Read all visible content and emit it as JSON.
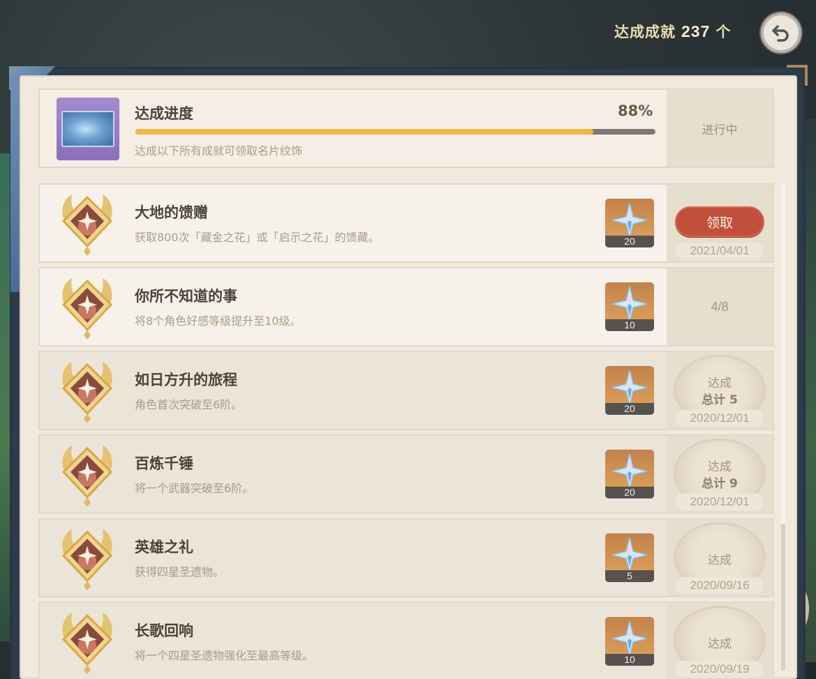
{
  "header": {
    "achieved_label": "达成成就",
    "achieved_count": "237",
    "achieved_unit": "个",
    "back_icon": "back-arrow-icon"
  },
  "progress": {
    "title": "达成进度",
    "percent_label": "88%",
    "percent_value": 88,
    "subtitle": "达成以下所有成就可领取名片纹饰",
    "status": "进行中",
    "colors": {
      "fill": "#f0b748",
      "track": "#7a7873"
    }
  },
  "achievements": [
    {
      "title": "大地的馈赠",
      "desc": "获取800次「藏金之花」或「启示之花」的馈藏。",
      "reward": "20",
      "claim_label": "领取",
      "date": "2021/04/01"
    },
    {
      "title": "你所不知道的事",
      "desc": "将8个角色好感等级提升至10级。",
      "reward": "10",
      "progress": "4/8"
    },
    {
      "title": "如日方升的旅程",
      "desc": "角色首次突破至6阶。",
      "reward": "20",
      "done_label": "达成",
      "total": "总计 5",
      "date": "2020/12/01"
    },
    {
      "title": "百炼千锤",
      "desc": "将一个武器突破至6阶。",
      "reward": "20",
      "done_label": "达成",
      "total": "总计 9",
      "date": "2020/12/01"
    },
    {
      "title": "英雄之礼",
      "desc": "获得四星圣遗物。",
      "reward": "5",
      "done_label": "达成",
      "date": "2020/09/16"
    },
    {
      "title": "长歌回响",
      "desc": "将一个四星圣遗物强化至最高等级。",
      "reward": "10",
      "done_label": "达成",
      "date": "2020/09/19"
    }
  ],
  "colors": {
    "accent_claim": "#c1503b",
    "panel_bg": "#efe9de",
    "title_text": "#4f4236"
  }
}
